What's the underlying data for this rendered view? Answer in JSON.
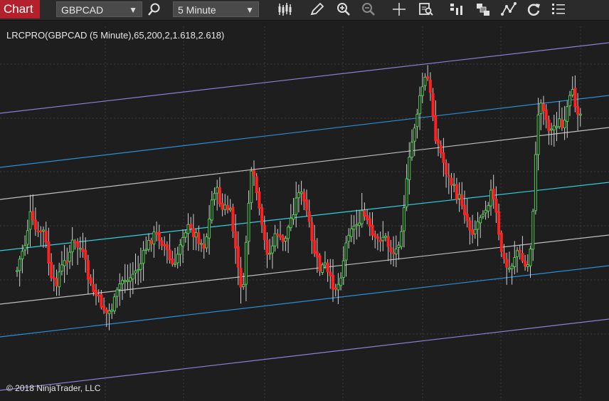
{
  "toolbar": {
    "chart_tab": "Chart",
    "instrument": "GBPCAD",
    "interval": "5 Minute",
    "icons": [
      "search-icon",
      "bar-type-icon",
      "pencil-icon",
      "zoom-in-icon",
      "zoom-out-icon",
      "crosshair-icon",
      "data-box-icon",
      "volume-bars-icon",
      "templates-icon",
      "drawing-tools-icon",
      "refresh-icon",
      "list-icon"
    ]
  },
  "chart": {
    "indicator_label": "LRCPRO(GBPCAD (5 Minute),65,200,2,1.618,2.618)",
    "copyright": "© 2018 NinjaTrader, LLC",
    "colors": {
      "background": "#1e1e1e",
      "up_candle": "#1e1e1e",
      "up_candle_outline": "#4ec94e",
      "down_candle": "#ff2020",
      "wick": "#d0d0d0",
      "grid": "#3a3a3a",
      "center_line": "#2fd0e0",
      "inner_band": "#bfbfbf",
      "middle_band": "#2a8fd8",
      "outer_band": "#8e7fd8"
    }
  },
  "chart_data": {
    "type": "candlestick",
    "instrument": "GBPCAD",
    "interval": "5 Minute",
    "indicator": "LRCPRO",
    "parameters": [
      65,
      200,
      2,
      1.618,
      2.618
    ],
    "price_path": [
      [
        0,
        380
      ],
      [
        6,
        370
      ],
      [
        12,
        355
      ],
      [
        18,
        345
      ],
      [
        24,
        380
      ],
      [
        30,
        355
      ],
      [
        36,
        340
      ],
      [
        42,
        300
      ],
      [
        48,
        320
      ],
      [
        54,
        330
      ],
      [
        60,
        320
      ],
      [
        66,
        350
      ],
      [
        72,
        395
      ],
      [
        78,
        400
      ],
      [
        84,
        380
      ],
      [
        90,
        370
      ],
      [
        96,
        360
      ],
      [
        102,
        340
      ],
      [
        108,
        345
      ],
      [
        114,
        350
      ],
      [
        120,
        370
      ],
      [
        126,
        400
      ],
      [
        132,
        410
      ],
      [
        138,
        420
      ],
      [
        144,
        430
      ],
      [
        150,
        440
      ],
      [
        156,
        435
      ],
      [
        162,
        420
      ],
      [
        168,
        400
      ],
      [
        174,
        390
      ],
      [
        180,
        395
      ],
      [
        186,
        385
      ],
      [
        192,
        380
      ],
      [
        198,
        370
      ],
      [
        204,
        350
      ],
      [
        210,
        340
      ],
      [
        216,
        330
      ],
      [
        222,
        330
      ],
      [
        228,
        340
      ],
      [
        234,
        350
      ],
      [
        240,
        370
      ],
      [
        246,
        375
      ],
      [
        252,
        345
      ],
      [
        258,
        325
      ],
      [
        264,
        320
      ],
      [
        270,
        325
      ],
      [
        276,
        330
      ],
      [
        282,
        340
      ],
      [
        288,
        345
      ],
      [
        294,
        310
      ],
      [
        300,
        265
      ],
      [
        306,
        270
      ],
      [
        312,
        295
      ],
      [
        318,
        290
      ],
      [
        324,
        300
      ],
      [
        330,
        340
      ],
      [
        336,
        390
      ],
      [
        342,
        410
      ],
      [
        348,
        300
      ],
      [
        354,
        240
      ],
      [
        360,
        265
      ],
      [
        366,
        310
      ],
      [
        372,
        340
      ],
      [
        378,
        360
      ],
      [
        384,
        340
      ],
      [
        390,
        325
      ],
      [
        396,
        345
      ],
      [
        402,
        330
      ],
      [
        408,
        310
      ],
      [
        414,
        290
      ],
      [
        420,
        265
      ],
      [
        426,
        280
      ],
      [
        432,
        300
      ],
      [
        438,
        340
      ],
      [
        444,
        360
      ],
      [
        450,
        380
      ],
      [
        456,
        370
      ],
      [
        462,
        390
      ],
      [
        468,
        400
      ],
      [
        474,
        405
      ],
      [
        480,
        380
      ],
      [
        486,
        345
      ],
      [
        492,
        315
      ],
      [
        498,
        320
      ],
      [
        504,
        310
      ],
      [
        510,
        300
      ],
      [
        516,
        310
      ],
      [
        522,
        330
      ],
      [
        528,
        340
      ],
      [
        534,
        335
      ],
      [
        540,
        330
      ],
      [
        546,
        345
      ],
      [
        552,
        355
      ],
      [
        558,
        350
      ],
      [
        564,
        320
      ],
      [
        570,
        270
      ],
      [
        576,
        220
      ],
      [
        582,
        180
      ],
      [
        588,
        150
      ],
      [
        594,
        120
      ],
      [
        600,
        105
      ],
      [
        606,
        140
      ],
      [
        612,
        190
      ],
      [
        618,
        210
      ],
      [
        624,
        230
      ],
      [
        630,
        250
      ],
      [
        636,
        260
      ],
      [
        642,
        275
      ],
      [
        648,
        280
      ],
      [
        654,
        300
      ],
      [
        660,
        320
      ],
      [
        666,
        325
      ],
      [
        672,
        310
      ],
      [
        678,
        295
      ],
      [
        684,
        290
      ],
      [
        690,
        270
      ],
      [
        696,
        290
      ],
      [
        702,
        340
      ],
      [
        708,
        365
      ],
      [
        714,
        380
      ],
      [
        720,
        370
      ],
      [
        726,
        350
      ],
      [
        732,
        360
      ],
      [
        738,
        375
      ],
      [
        744,
        370
      ],
      [
        750,
        280
      ],
      [
        756,
        160
      ],
      [
        762,
        140
      ],
      [
        768,
        170
      ],
      [
        774,
        185
      ],
      [
        780,
        175
      ],
      [
        786,
        170
      ],
      [
        792,
        185
      ],
      [
        798,
        150
      ],
      [
        804,
        130
      ],
      [
        810,
        150
      ],
      [
        816,
        160
      ]
    ],
    "regression_channel": {
      "center": [
        [
          0,
          352
        ],
        [
          856,
          256
        ]
      ],
      "bands": [
        {
          "level": "inner",
          "upper": [
            [
              0,
              280
            ],
            [
              856,
              179
            ]
          ],
          "lower": [
            [
              0,
              427
            ],
            [
              856,
              330
            ]
          ]
        },
        {
          "level": "middle",
          "upper": [
            [
              0,
              235
            ],
            [
              856,
              134
            ]
          ],
          "lower": [
            [
              0,
              473
            ],
            [
              856,
              373
            ]
          ]
        },
        {
          "level": "outer",
          "upper": [
            [
              0,
              159
            ],
            [
              856,
              60
            ]
          ],
          "lower": [
            [
              0,
              548
            ],
            [
              856,
              448
            ]
          ]
        }
      ]
    },
    "grid": true
  }
}
